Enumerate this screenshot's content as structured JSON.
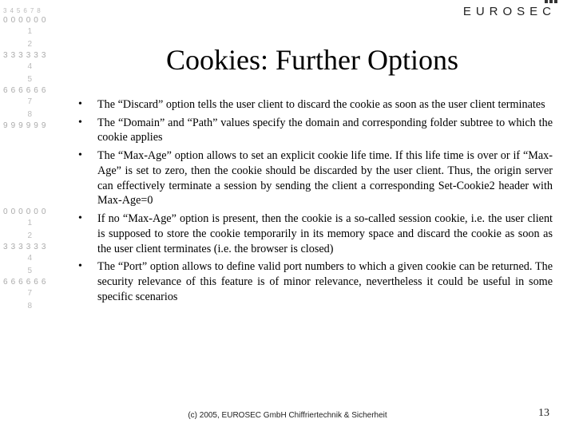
{
  "brand": "EUROSEC",
  "title": "Cookies: Further Options",
  "bullets": [
    "The “Discard” option tells the user client to discard the cookie as soon as the user client terminates",
    "The “Domain” and “Path” values specify the domain and corresponding folder subtree to which the cookie applies",
    "The “Max-Age” option allows to set an explicit cookie life time. If this life time is over or if “Max-Age” is set to zero, then the cookie should be discarded by the user client. Thus, the origin server can effectively terminate a session by sending the client a corresponding Set-Cookie2 header with Max-Age=0",
    "If no “Max-Age” option is present, then the cookie is a so-called session cookie, i.e. the user client is supposed to store the cookie temporarily in its memory space and discard the cookie as soon as the user client terminates (i.e. the browser is closed)",
    "The “Port” option allows to define valid port numbers to which a given cookie can be returned. The security relevance of this feature is of minor relevance, nevertheless it could be useful in some specific scenarios"
  ],
  "footer": {
    "copyright": "(c) 2005, EUROSEC GmbH Chiffriertechnik & Sicherheit",
    "page_number": "13"
  },
  "decor": {
    "rows": [
      "3 4 5 6 7 8",
      "0 0 0 0 0 0",
      "1",
      "2",
      "3 3 3 3 3 3",
      "4",
      "5",
      "6 6 6 6 6 6",
      "7",
      "8",
      "9 9 9 9 9 9"
    ]
  }
}
